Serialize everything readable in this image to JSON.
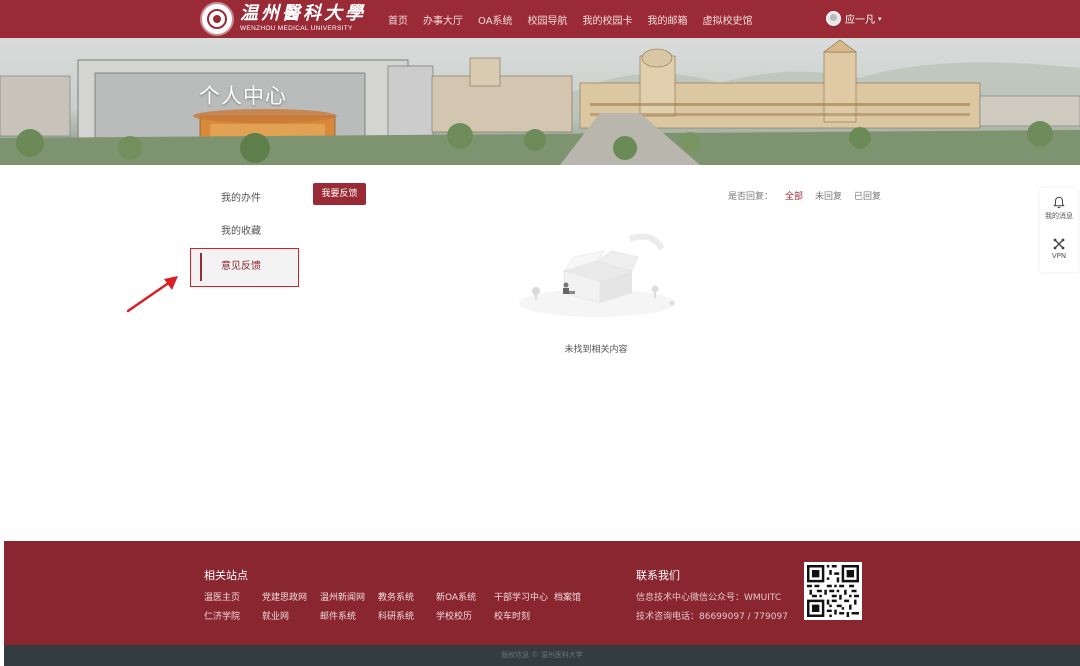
{
  "header": {
    "logo_cn": "温州醫科大學",
    "logo_en": "WENZHOU MEDICAL UNIVERSITY",
    "nav": [
      "首页",
      "办事大厅",
      "OA系统",
      "校园导航",
      "我的校园卡",
      "我的邮箱",
      "虚拟校史馆"
    ],
    "user_name": "应一凡",
    "caret": "▾"
  },
  "banner": {
    "title": "个人中心"
  },
  "sidebar": {
    "items": [
      {
        "label": "我的办件"
      },
      {
        "label": "我的收藏"
      },
      {
        "label": "意见反馈"
      }
    ],
    "active_index": 2
  },
  "main": {
    "feedback_button": "我要反馈",
    "filter_label": "是否回复：",
    "filter_options": [
      "全部",
      "未回复",
      "已回复"
    ],
    "active_filter": "全部",
    "empty_text": "未找到相关内容"
  },
  "float_panel": {
    "items": [
      {
        "label": "我的消息",
        "icon": "bell-icon"
      },
      {
        "label": "VPN",
        "icon": "vpn-icon"
      }
    ]
  },
  "footer": {
    "links_title": "相关站点",
    "links_row1": [
      "温医主页",
      "党建思政网",
      "温州新闻网",
      "教务系统",
      "新OA系统",
      "干部学习中心",
      "档案馆"
    ],
    "links_row2": [
      "仁济学院",
      "就业网",
      "邮件系统",
      "科研系统",
      "学校校历",
      "校车时刻"
    ],
    "contact_title": "联系我们",
    "contact_lines": [
      "信息技术中心微信公众号：WMUITC",
      "技术咨询电话：86699097 / 779097"
    ],
    "copyright": "版权信息 © 温州医科大学"
  },
  "colors": {
    "brand": "#9a2a35",
    "footer": "#8a2630",
    "footer_bottom": "#333c3e",
    "annotation": "#d81f26"
  }
}
